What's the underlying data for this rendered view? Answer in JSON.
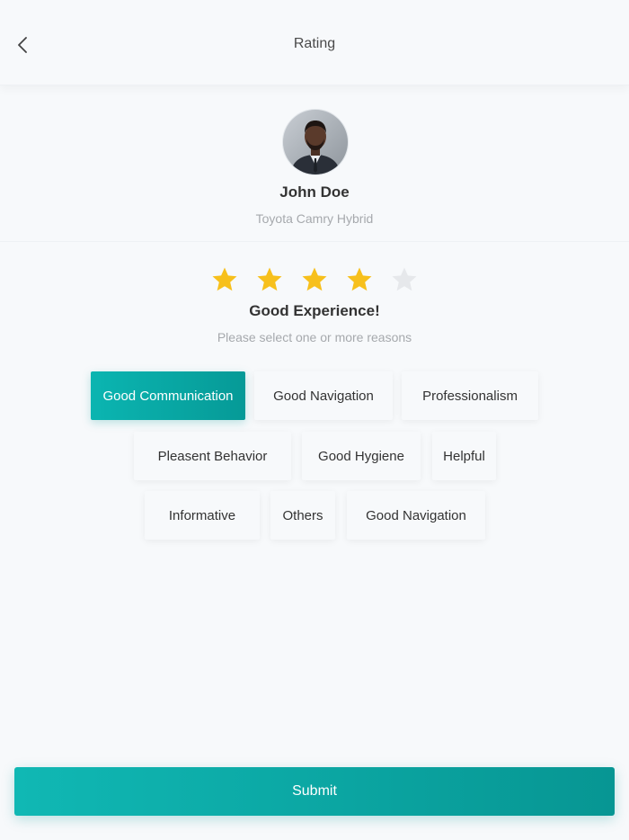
{
  "header": {
    "title": "Rating",
    "back_icon": "chevron-left-icon"
  },
  "driver": {
    "name": "John Doe",
    "car": "Toyota Camry Hybrid"
  },
  "rating": {
    "value": 4,
    "max": 5,
    "label": "Good Experience!",
    "prompt": "Please select one or more reasons",
    "star_color": "#f7c01c",
    "empty_star_color": "#e6e8eb"
  },
  "reasons": [
    {
      "label": "Good Communication",
      "selected": true
    },
    {
      "label": "Good Navigation",
      "selected": false
    },
    {
      "label": "Professionalism",
      "selected": false
    },
    {
      "label": "Pleasent Behavior",
      "selected": false
    },
    {
      "label": "Good Hygiene",
      "selected": false
    },
    {
      "label": "Helpful",
      "selected": false
    },
    {
      "label": "Informative",
      "selected": false
    },
    {
      "label": "Others",
      "selected": false
    },
    {
      "label": "Good Navigation",
      "selected": false
    }
  ],
  "submit_label": "Submit",
  "accent_color": "#0aa9a6"
}
